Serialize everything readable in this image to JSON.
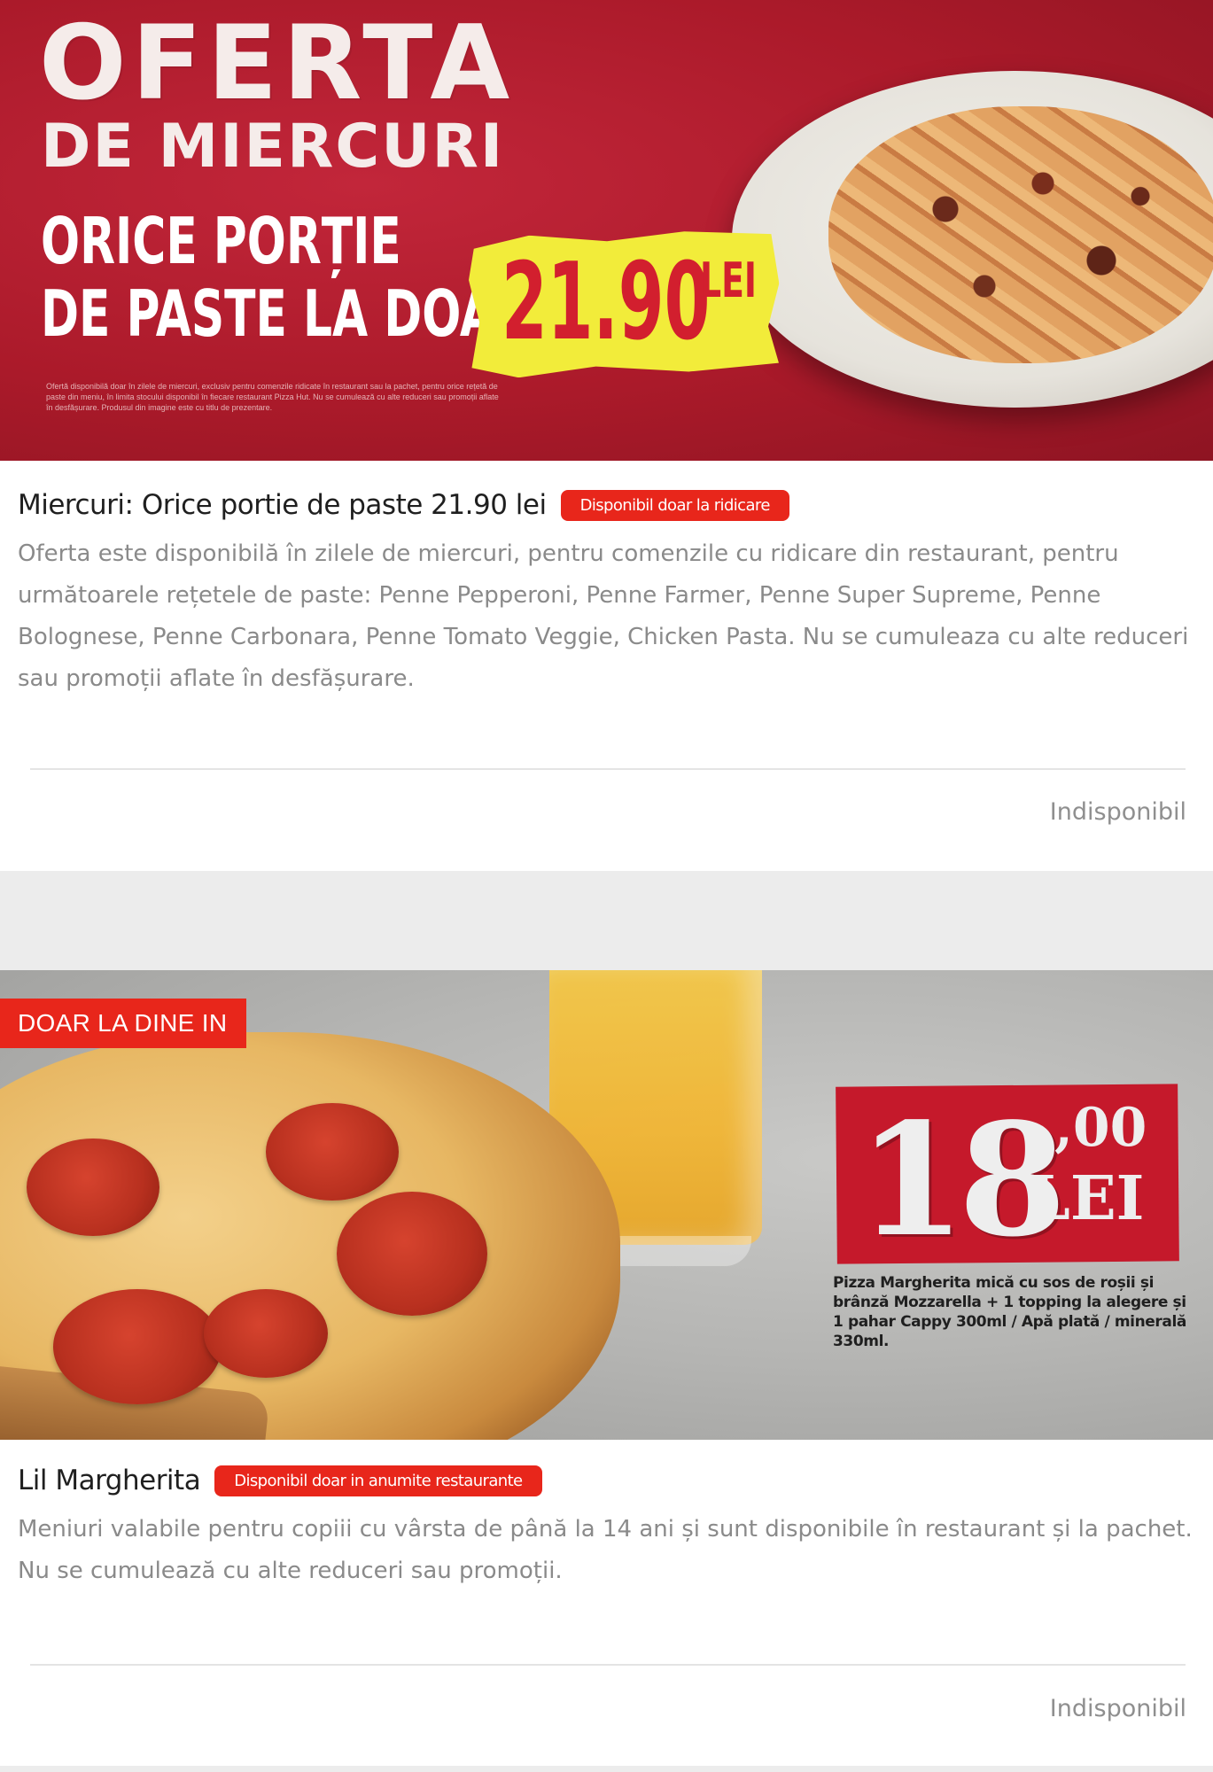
{
  "promo1": {
    "banner": {
      "headline": "OFERTA",
      "subheadline": "DE MIERCURI",
      "line1": "ORICE PORȚIE",
      "line2": "DE PASTE LA DOAR",
      "price": "21.90",
      "currency": "LEI",
      "fineprint": "Ofertă disponibilă doar în zilele de miercuri, exclusiv pentru comenzile ridicate în restaurant sau la pachet, pentru orice rețetă de paste din meniu, în limita stocului disponibil în fiecare restaurant Pizza Hut. Nu se cumulează cu alte reduceri sau promoții aflate în desfășurare. Produsul din imagine este cu titlu de prezentare.",
      "colors": {
        "background": "#b31d2c",
        "price_highlight": "#f2ec3a",
        "price_text": "#d21f2e"
      }
    },
    "title": "Miercuri: Orice portie de paste 21.90 lei",
    "badge": "Disponibil doar la ridicare",
    "description": "Oferta este disponibilă în zilele de miercuri, pentru comenzile cu ridicare din restaurant, pentru următoarele rețetele de paste: Penne Pepperoni, Penne Farmer, Penne Super Supreme, Penne Bolognese, Penne Carbonara, Penne Tomato Veggie, Chicken Pasta. Nu se cumuleaza cu alte reduceri sau promoții aflate în desfășurare.",
    "status": "Indisponibil"
  },
  "promo2": {
    "banner": {
      "dine_badge": "DOAR LA DINE IN",
      "price_main": "18",
      "price_decimal": ",00",
      "currency": "LEI",
      "note": "Pizza Margherita mică cu sos de roșii și brânză Mozzarella + 1 topping la alegere și 1 pahar Cappy 300ml / Apă plată / minerală 330ml.",
      "colors": {
        "price_box": "#c5192b",
        "badge": "#e8261b"
      }
    },
    "title": "Lil Margherita",
    "badge": "Disponibil doar in anumite restaurante",
    "description": "Meniuri valabile pentru copiii cu vârsta de până la 14 ani și sunt disponibile în restaurant și la pachet. Nu se cumulează cu alte reduceri sau promoții.",
    "status": "Indisponibil"
  },
  "theme": {
    "accent": "#e8261b",
    "page_background": "#ececec",
    "card_background": "#ffffff"
  }
}
